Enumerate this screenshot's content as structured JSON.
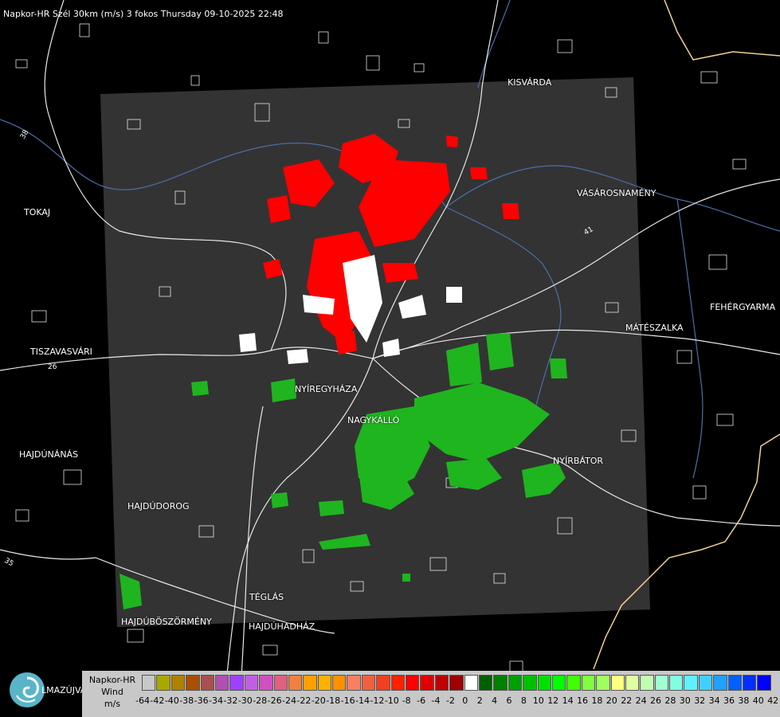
{
  "header": {
    "title": "Napkor-HR Szél 30km (m/s) 3 fokos Thursday 09-10-2025 22:48"
  },
  "cities": [
    {
      "id": "kisvarda",
      "name": "KISVÁRDA"
    },
    {
      "id": "vasarosnameny",
      "name": "VÁSÁROSNAMÉNY"
    },
    {
      "id": "tokaj",
      "name": "TOKAJ"
    },
    {
      "id": "fehergyarmat",
      "name": "FEHÉRGYARMA"
    },
    {
      "id": "mateszalka",
      "name": "MÁTÉSZALKA"
    },
    {
      "id": "tiszavasvari",
      "name": "TISZAVASVÁRI"
    },
    {
      "id": "nyiregyhaza",
      "name": "NYÍREGYHÁZA"
    },
    {
      "id": "nagykallo",
      "name": "NAGYKÁLLÓ"
    },
    {
      "id": "hajdunanas",
      "name": "HAJDÚNÁNÁS"
    },
    {
      "id": "nyirbator",
      "name": "NYÍRBÁTOR"
    },
    {
      "id": "hajdudorog",
      "name": "HAJDÚDOROG"
    },
    {
      "id": "teglas",
      "name": "TÉGLÁS"
    },
    {
      "id": "hajduboszormeny",
      "name": "HAJDÚBÖSZÖRMÉNY"
    },
    {
      "id": "hajduhadhaz",
      "name": "HAJDÚHADHÁZ"
    }
  ],
  "road_numbers": [
    "38",
    "26",
    "35",
    "41"
  ],
  "logo": {
    "text": "LMAZÚJVÁR",
    "icon": "swirl-logo-icon"
  },
  "legend": {
    "label_lines": [
      "Napkor-HR",
      "Wind",
      "m/s"
    ],
    "tick_labels": [
      "-64",
      "-42",
      "-40",
      "-38",
      "-36",
      "-34",
      "-32",
      "-30",
      "-28",
      "-26",
      "-24",
      "-22",
      "-20",
      "-18",
      "-16",
      "-14",
      "-12",
      "-10",
      "-8",
      "-6",
      "-4",
      "-2",
      "0",
      "2",
      "4",
      "6",
      "8",
      "10",
      "12",
      "14",
      "16",
      "18",
      "20",
      "22",
      "24",
      "26",
      "28",
      "30",
      "32",
      "34",
      "36",
      "38",
      "40",
      "42"
    ],
    "colors": [
      "#c8c8c8",
      "#a8a800",
      "#b08000",
      "#a85000",
      "#a85050",
      "#b050b0",
      "#a040ff",
      "#c060e0",
      "#d050c0",
      "#e06080",
      "#f08040",
      "#ffa000",
      "#ffb000",
      "#ff9000",
      "#f88060",
      "#f06040",
      "#f04020",
      "#ff2000",
      "#ff0000",
      "#e00000",
      "#c00000",
      "#a00000",
      "#ffffff",
      "#006000",
      "#008000",
      "#00a000",
      "#00c000",
      "#00e000",
      "#00ff00",
      "#40ff00",
      "#80ff40",
      "#a0ff60",
      "#ffff80",
      "#e0ffa0",
      "#c0ffb0",
      "#a0ffd0",
      "#80ffe0",
      "#60f0ff",
      "#40d0ff",
      "#20a0ff",
      "#0060ff",
      "#0030ff",
      "#0000ff"
    ]
  },
  "colors": {
    "radar_bg": "#333333",
    "receding": "#ff0000",
    "approaching": "#00c000",
    "near_zero": "#ffffff",
    "border": "#f0d090",
    "river": "#4a6fa5"
  }
}
